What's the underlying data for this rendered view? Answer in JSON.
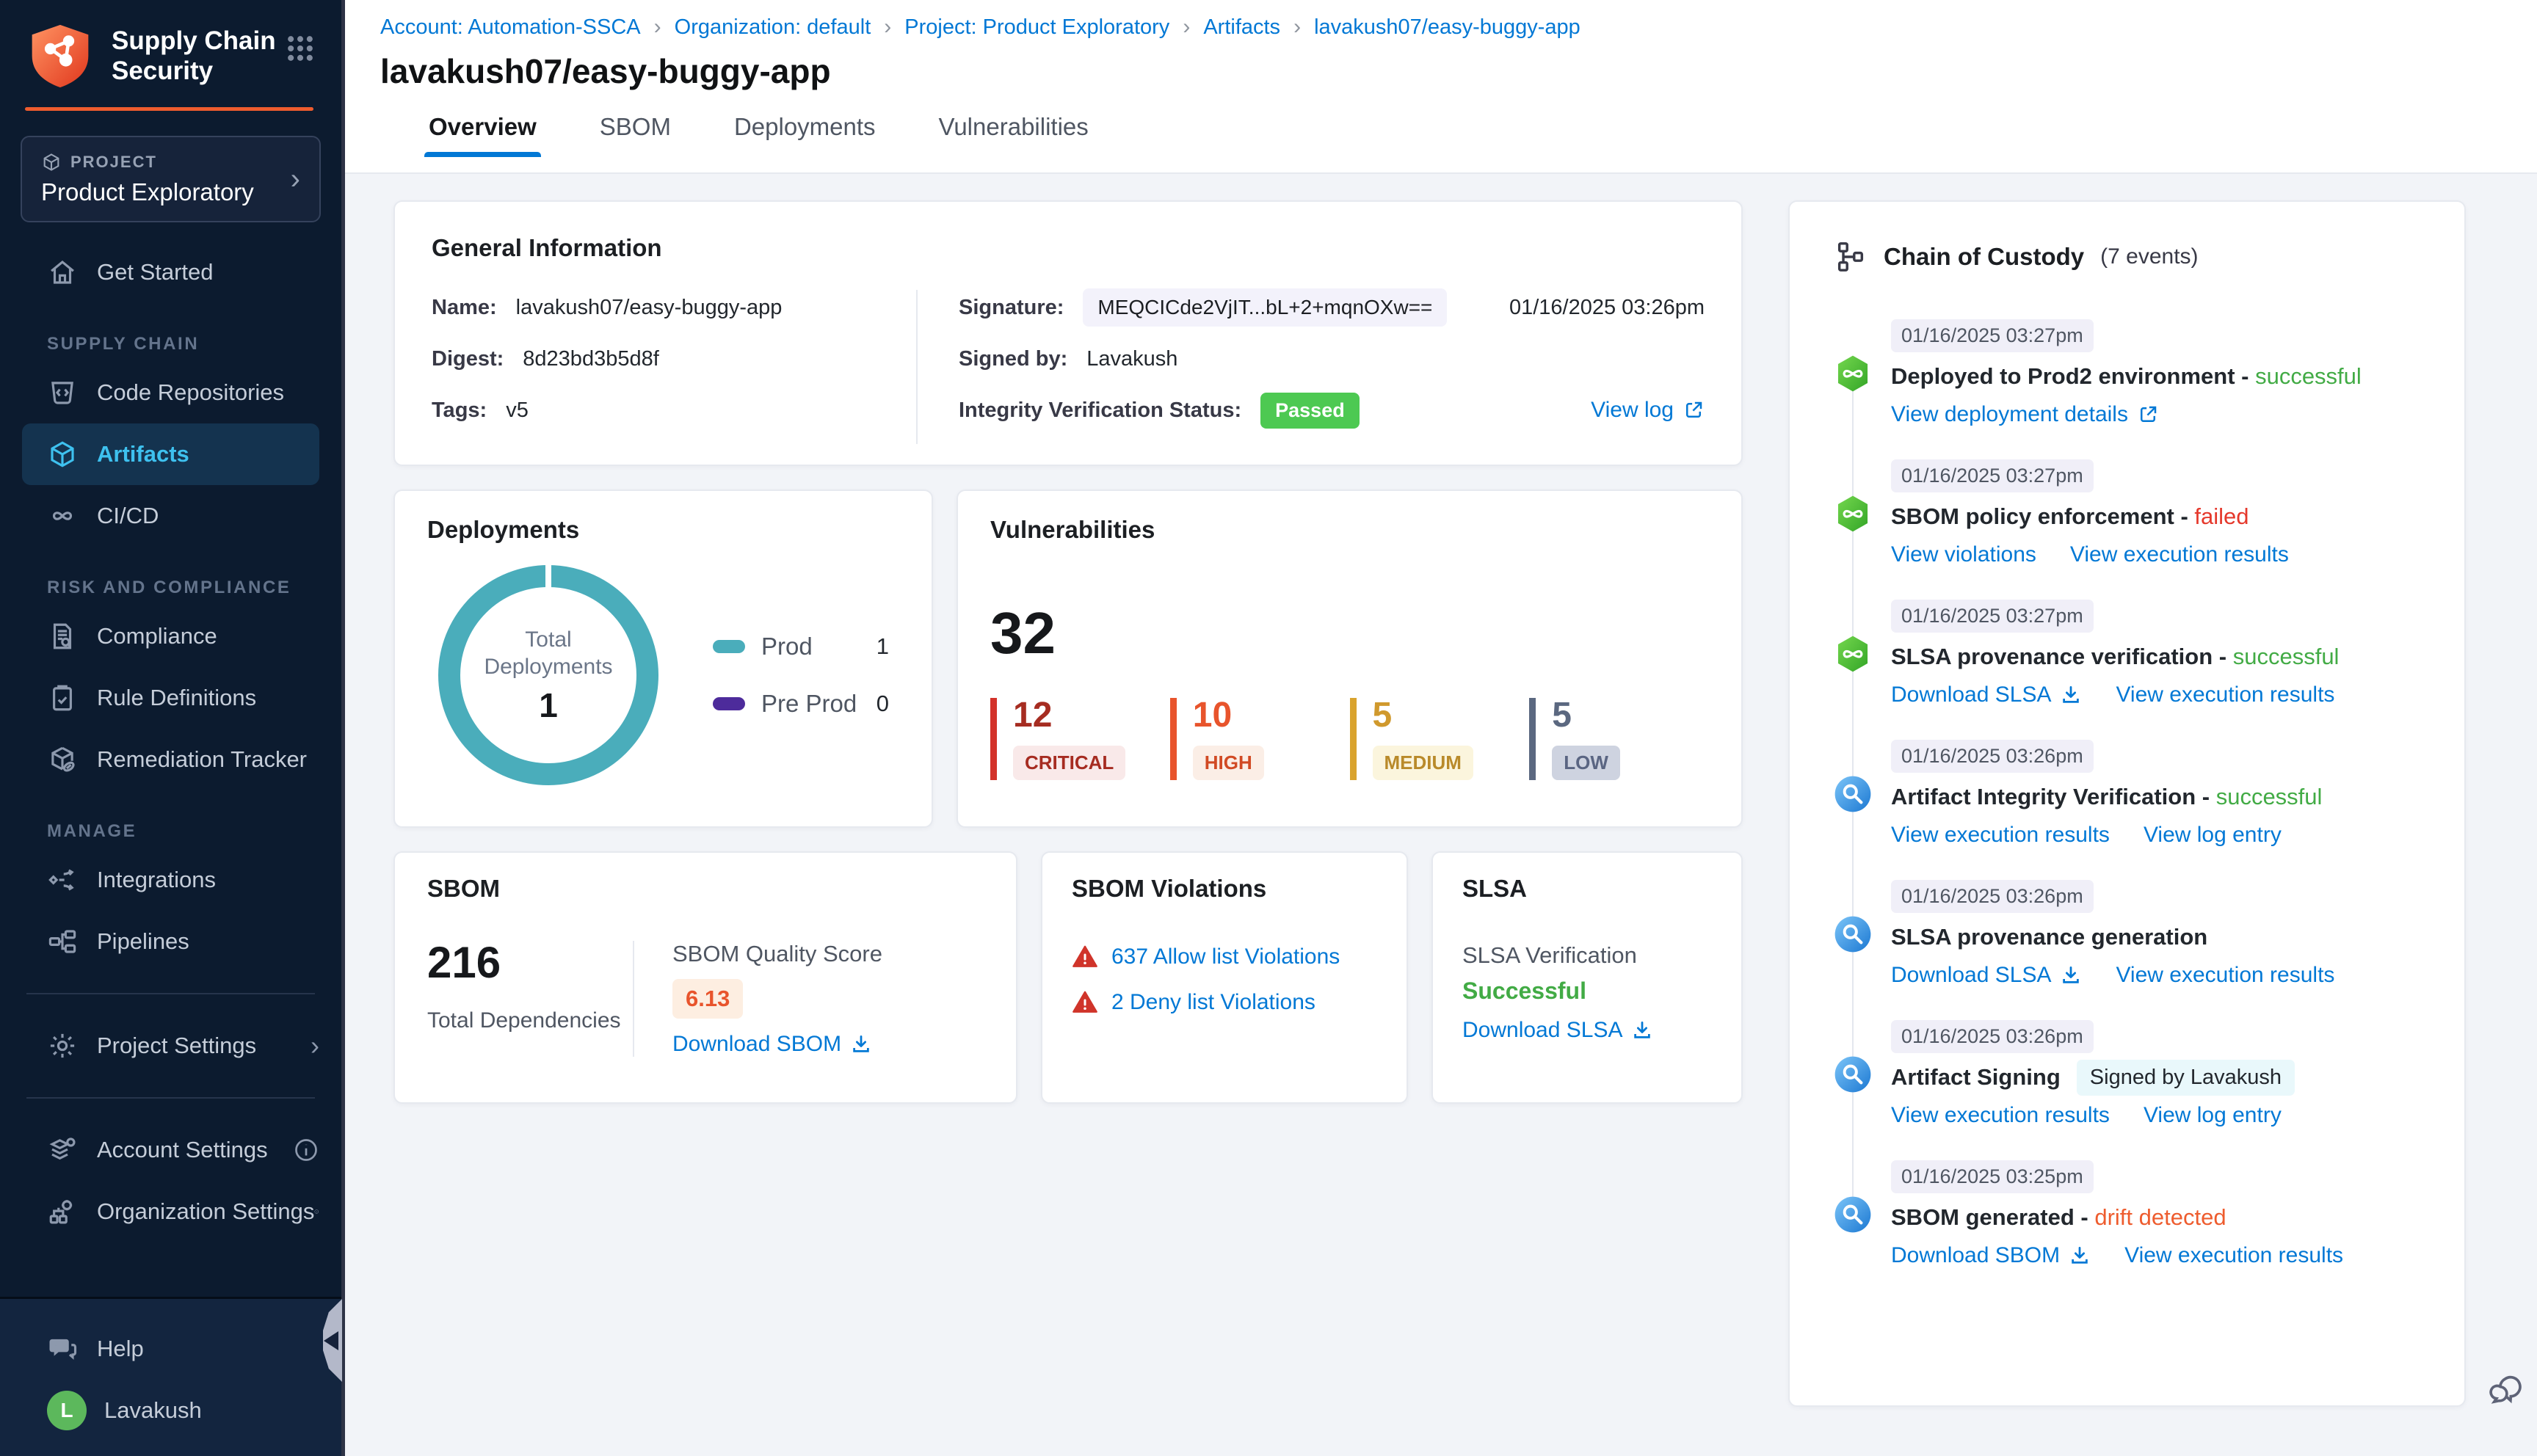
{
  "brand": {
    "accent_orange": "#ee5c2e",
    "link_blue": "#0278d5",
    "success_green": "#42ab45",
    "fail_red": "#e5382b",
    "drift_orange": "#ee5c2e"
  },
  "sidebar": {
    "app_title_line1": "Supply Chain",
    "app_title_line2": "Security",
    "project_label": "PROJECT",
    "project_name": "Product Exploratory",
    "nav": {
      "get_started": "Get Started",
      "sections": [
        {
          "label": "SUPPLY CHAIN",
          "items": [
            "Code Repositories",
            "Artifacts",
            "CI/CD"
          ]
        },
        {
          "label": "RISK AND COMPLIANCE",
          "items": [
            "Compliance",
            "Rule Definitions",
            "Remediation Tracker"
          ]
        },
        {
          "label": "MANAGE",
          "items": [
            "Integrations",
            "Pipelines"
          ]
        }
      ],
      "active_item": "Artifacts",
      "project_settings": "Project Settings",
      "account_settings": "Account Settings",
      "organization_settings": "Organization Settings",
      "help": "Help"
    },
    "user": {
      "name": "Lavakush",
      "initial": "L"
    }
  },
  "breadcrumb": {
    "items": [
      "Account: Automation-SSCA",
      "Organization: default",
      "Project: Product Exploratory",
      "Artifacts",
      "lavakush07/easy-buggy-app"
    ]
  },
  "page_title": "lavakush07/easy-buggy-app",
  "tabs": {
    "items": [
      "Overview",
      "SBOM",
      "Deployments",
      "Vulnerabilities"
    ],
    "active": "Overview"
  },
  "general_info": {
    "title": "General Information",
    "name_label": "Name:",
    "name": "lavakush07/easy-buggy-app",
    "digest_label": "Digest:",
    "digest": "8d23bd3b5d8f",
    "tags_label": "Tags:",
    "tags": "v5",
    "signature_label": "Signature:",
    "signature": "MEQCICde2VjIT...bL+2+mqnOXw==",
    "signature_time": "01/16/2025 03:26pm",
    "signed_by_label": "Signed by:",
    "signed_by": "Lavakush",
    "integrity_label": "Integrity Verification Status:",
    "integrity_status": "Passed",
    "view_log": "View log"
  },
  "deployments_card": {
    "title": "Deployments",
    "center_line1": "Total",
    "center_line2": "Deployments",
    "center_value": "1",
    "legend": [
      {
        "label": "Prod",
        "value": "1",
        "color": "#4aadbb"
      },
      {
        "label": "Pre Prod",
        "value": "0",
        "color": "#4d2b9b"
      }
    ]
  },
  "vulnerabilities_card": {
    "title": "Vulnerabilities",
    "total": "32",
    "severities": [
      {
        "count": "12",
        "label": "CRITICAL",
        "color": "#a62c21",
        "bar_color": "#d3322a"
      },
      {
        "count": "10",
        "label": "HIGH",
        "color": "#e8542c",
        "bar_color": "#e8542c"
      },
      {
        "count": "5",
        "label": "MEDIUM",
        "color": "#d0992d",
        "bar_color": "#d9a32e"
      },
      {
        "count": "5",
        "label": "LOW",
        "color": "#5b6880",
        "bar_color": "#5b6880"
      }
    ]
  },
  "sbom_card": {
    "title": "SBOM",
    "total": "216",
    "total_label": "Total Dependencies",
    "quality_label": "SBOM Quality Score",
    "quality_score": "6.13",
    "download_label": "Download SBOM"
  },
  "sbom_violations_card": {
    "title": "SBOM Violations",
    "items": [
      {
        "label": "637 Allow list Violations"
      },
      {
        "label": "2 Deny list Violations"
      }
    ]
  },
  "slsa_card": {
    "title": "SLSA",
    "verification_label": "SLSA Verification",
    "status": "Successful",
    "download_label": "Download SLSA"
  },
  "chain_of_custody": {
    "title": "Chain of Custody",
    "count_label": "(7 events)",
    "events": [
      {
        "time": "01/16/2025 03:27pm",
        "icon": "pipeline",
        "title": "Deployed to Prod2 environment",
        "status": "successful",
        "status_color": "#42ab45",
        "links": [
          {
            "label": "View deployment details",
            "icon": "external"
          }
        ]
      },
      {
        "time": "01/16/2025 03:27pm",
        "icon": "pipeline",
        "title": "SBOM policy enforcement",
        "status": "failed",
        "status_color": "#e5382b",
        "links": [
          {
            "label": "View violations"
          },
          {
            "label": "View execution results"
          }
        ]
      },
      {
        "time": "01/16/2025 03:27pm",
        "icon": "pipeline",
        "title": "SLSA provenance verification",
        "status": "successful",
        "status_color": "#42ab45",
        "links": [
          {
            "label": "Download SLSA",
            "icon": "download"
          },
          {
            "label": "View execution results"
          }
        ]
      },
      {
        "time": "01/16/2025 03:26pm",
        "icon": "scan",
        "title": "Artifact Integrity Verification",
        "status": "successful",
        "status_color": "#42ab45",
        "links": [
          {
            "label": "View execution results"
          },
          {
            "label": "View log entry"
          }
        ]
      },
      {
        "time": "01/16/2025 03:26pm",
        "icon": "scan",
        "title": "SLSA provenance generation",
        "links": [
          {
            "label": "Download SLSA",
            "icon": "download"
          },
          {
            "label": "View execution results"
          }
        ]
      },
      {
        "time": "01/16/2025 03:26pm",
        "icon": "scan",
        "title": "Artifact Signing",
        "badge": "Signed by Lavakush",
        "links": [
          {
            "label": "View execution results"
          },
          {
            "label": "View log entry"
          }
        ]
      },
      {
        "time": "01/16/2025 03:25pm",
        "icon": "scan",
        "title": "SBOM generated",
        "status": "drift detected",
        "status_color": "#ee5c2e",
        "links": [
          {
            "label": "Download SBOM",
            "icon": "download"
          },
          {
            "label": "View execution results"
          }
        ]
      }
    ]
  },
  "chart_data": [
    {
      "type": "pie",
      "title": "Deployments",
      "categories": [
        "Prod",
        "Pre Prod"
      ],
      "values": [
        1,
        0
      ],
      "colors": [
        "#4aadbb",
        "#4d2b9b"
      ],
      "donut": true,
      "center_label": "Total Deployments",
      "center_value": 1,
      "legend_position": "right"
    },
    {
      "type": "bar",
      "title": "Vulnerabilities by severity",
      "categories": [
        "CRITICAL",
        "HIGH",
        "MEDIUM",
        "LOW"
      ],
      "values": [
        12,
        10,
        5,
        5
      ],
      "total": 32
    }
  ]
}
